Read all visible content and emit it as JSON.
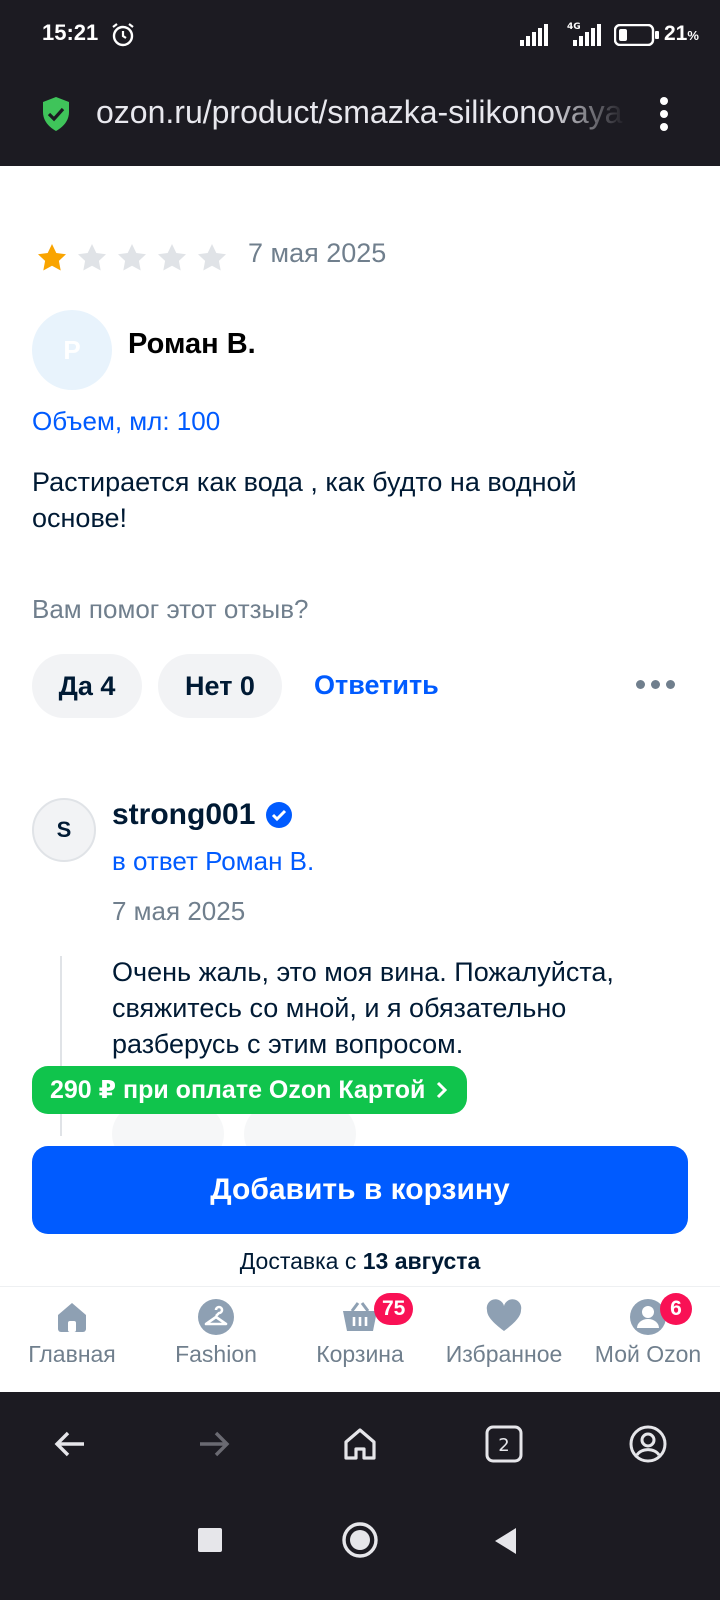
{
  "status_bar": {
    "time": "15:21",
    "battery": "21",
    "battery_unit": "%",
    "network": "4G"
  },
  "browser": {
    "url": "ozon.ru/product/smazka-silikonovaya",
    "tabs_count": "2"
  },
  "review": {
    "rating": 1,
    "rating_max": 5,
    "date": "7 мая 2025",
    "avatar_letter": "Р",
    "author": "Роман В.",
    "variant": "Объем, мл: 100",
    "text": "Растирается как вода , как будто на водной основе!",
    "helpful_question": "Вам помог этот отзыв?",
    "yes_label": "Да 4",
    "no_label": "Нет 0",
    "reply_label": "Ответить"
  },
  "seller_reply": {
    "avatar_letter": "S",
    "name": "strong001",
    "reply_to": "в ответ Роман В.",
    "date": "7 мая 2025",
    "text": "Очень жаль, это моя вина. Пожалуйста, свяжитесь со мной, и я обязательно разберусь с этим вопросом."
  },
  "promo": {
    "label": "290 ₽ при оплате Ozon Картой"
  },
  "cart": {
    "button_label": "Добавить в корзину",
    "delivery_prefix": "Доставка с ",
    "delivery_date": "13 августа"
  },
  "tabbar": {
    "items": [
      {
        "label": "Главная",
        "icon": "home-icon"
      },
      {
        "label": "Fashion",
        "icon": "hanger-icon"
      },
      {
        "label": "Корзина",
        "icon": "basket-icon",
        "badge": "75"
      },
      {
        "label": "Избранное",
        "icon": "heart-icon"
      },
      {
        "label": "Мой Ozon",
        "icon": "profile-icon",
        "badge": "6"
      }
    ]
  },
  "colors": {
    "accent": "#005bff",
    "promo": "#10c44c",
    "badge": "#f91155",
    "star": "#f9a400",
    "star_empty": "#e0e3e7"
  }
}
